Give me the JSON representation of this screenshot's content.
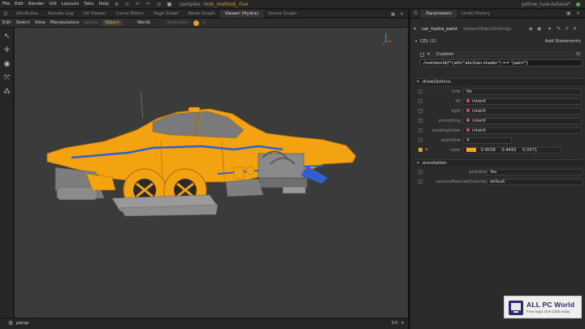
{
  "menubar": {
    "items": [
      "File",
      "Edit",
      "Render",
      "Util",
      "Layouts",
      "Tabs",
      "Help"
    ],
    "project_label": "samples:",
    "project_name": "look_method_-live",
    "user": "yellow_luxe.katana*"
  },
  "viewer_tabs": [
    "Attributes",
    "Render Log",
    "UV Viewer",
    "Curve Editor",
    "Page Sheet",
    "Node Graph",
    "Viewer (Hydra)",
    "Scene Graph"
  ],
  "viewer_active_tab": "Viewer (Hydra)",
  "viewer_toolbar": {
    "menus": [
      "Edit",
      "Select",
      "View",
      "Manipulators"
    ],
    "space_label": "Space:",
    "space_object": "Object",
    "space_world": "World",
    "selection_label": "Selection:"
  },
  "viewport": {
    "background": "#3b3b3b",
    "car_color": "#f2a30f",
    "camera": "persp",
    "status_right": "EH"
  },
  "right_tabs": [
    "Parameters",
    "Undo History"
  ],
  "right_active_tab": "Parameters",
  "node": {
    "name": "car_hydra_paint",
    "type": "ViewerObjectSettings"
  },
  "cel": {
    "label": "CEL (1)",
    "add_label": "Add Statements",
    "custom_label": "Custom",
    "expression": "/root/world//*{attr(\"abcUser.shader\") == \"paint\"}"
  },
  "draw_options": {
    "title": "drawOptions",
    "rows": [
      {
        "label": "hide",
        "value": "No"
      },
      {
        "label": "fill",
        "value": "inherit"
      },
      {
        "label": "light",
        "value": "inherit"
      },
      {
        "label": "smoothing",
        "value": "inherit"
      },
      {
        "label": "windingOrder",
        "value": "inherit"
      },
      {
        "label": "pointSize",
        "value": "4"
      }
    ],
    "color": {
      "label": "color",
      "swatch": "#f5a716",
      "r": "0.9558",
      "g": "0.4493",
      "b": "0.0071"
    }
  },
  "annotation": {
    "title": "annotation",
    "rows": [
      {
        "label": "pickable",
        "value": "Yes"
      },
      {
        "label": "resolveMaterialOverride",
        "value": "default"
      }
    ]
  },
  "watermark": {
    "title": "ALL PC World",
    "subtitle": "Free Apps One Click Away"
  }
}
